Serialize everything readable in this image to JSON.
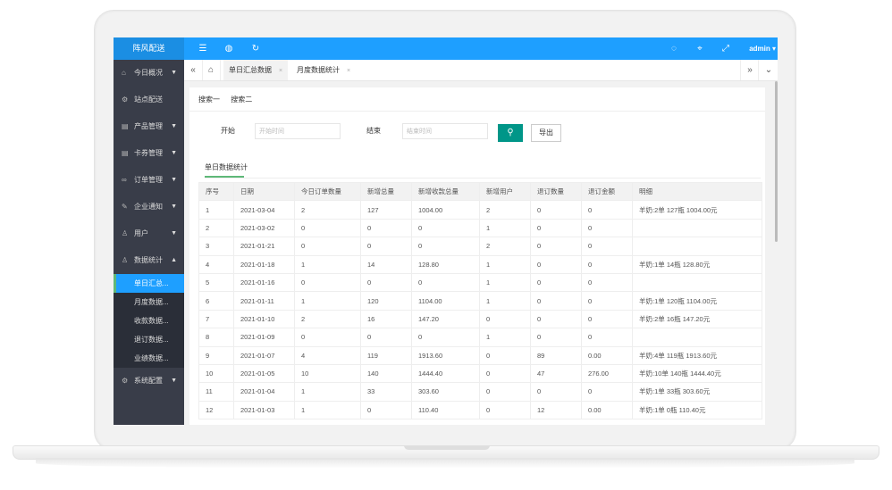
{
  "app": {
    "brand": "阵风配送",
    "user": "admin"
  },
  "topbar": {
    "icons": [
      "menu-icon",
      "globe-icon",
      "refresh-icon",
      "palette-icon",
      "tag-icon",
      "fullscreen-icon"
    ]
  },
  "sidebar": {
    "items": [
      {
        "label": "今日概况",
        "icon": "home-icon",
        "arrow": "▼"
      },
      {
        "label": "站点配送",
        "icon": "gear-icon",
        "arrow": ""
      },
      {
        "label": "产品管理",
        "icon": "doc-icon",
        "arrow": "▼"
      },
      {
        "label": "卡券管理",
        "icon": "doc-icon",
        "arrow": "▼"
      },
      {
        "label": "订单管理",
        "icon": "link-icon",
        "arrow": "▼"
      },
      {
        "label": "企业通知",
        "icon": "edit-icon",
        "arrow": "▼"
      },
      {
        "label": "用户",
        "icon": "user-icon",
        "arrow": "▼"
      },
      {
        "label": "数据统计",
        "icon": "user-icon",
        "arrow": "▲"
      }
    ],
    "subitems": [
      "单日汇总...",
      "月度数据...",
      "收款数据...",
      "退订数据...",
      "业绩数据..."
    ],
    "last": {
      "label": "系统配置",
      "icon": "gear-icon",
      "arrow": "▼"
    }
  },
  "tabs": {
    "home_icon": "⌂",
    "items": [
      {
        "label": "单日汇总数据",
        "close": "×"
      },
      {
        "label": "月度数据统计",
        "close": "×"
      }
    ]
  },
  "search": {
    "tabs": [
      "搜索一",
      "搜索二"
    ],
    "start_label": "开始",
    "start_placeholder": "开始时间",
    "end_label": "结束",
    "end_placeholder": "结束时间",
    "export_label": "导出"
  },
  "section_title": "单日数据统计",
  "table": {
    "headers": [
      "序号",
      "日期",
      "今日订单数量",
      "新增总量",
      "新增收款总量",
      "新增用户",
      "退订数量",
      "退订金额",
      "明细"
    ],
    "rows": [
      [
        "1",
        "2021-03-04",
        "2",
        "127",
        "1004.00",
        "2",
        "0",
        "0",
        "羊奶:2单 127瓶 1004.00元"
      ],
      [
        "2",
        "2021-03-02",
        "0",
        "0",
        "0",
        "1",
        "0",
        "0",
        ""
      ],
      [
        "3",
        "2021-01-21",
        "0",
        "0",
        "0",
        "2",
        "0",
        "0",
        ""
      ],
      [
        "4",
        "2021-01-18",
        "1",
        "14",
        "128.80",
        "1",
        "0",
        "0",
        "羊奶:1单 14瓶 128.80元"
      ],
      [
        "5",
        "2021-01-16",
        "0",
        "0",
        "0",
        "1",
        "0",
        "0",
        ""
      ],
      [
        "6",
        "2021-01-11",
        "1",
        "120",
        "1104.00",
        "1",
        "0",
        "0",
        "羊奶:1单 120瓶 1104.00元"
      ],
      [
        "7",
        "2021-01-10",
        "2",
        "16",
        "147.20",
        "0",
        "0",
        "0",
        "羊奶:2单 16瓶 147.20元"
      ],
      [
        "8",
        "2021-01-09",
        "0",
        "0",
        "0",
        "1",
        "0",
        "0",
        ""
      ],
      [
        "9",
        "2021-01-07",
        "4",
        "119",
        "1913.60",
        "0",
        "89",
        "0.00",
        "羊奶:4单 119瓶 1913.60元"
      ],
      [
        "10",
        "2021-01-05",
        "10",
        "140",
        "1444.40",
        "0",
        "47",
        "276.00",
        "羊奶:10单 140瓶 1444.40元"
      ],
      [
        "11",
        "2021-01-04",
        "1",
        "33",
        "303.60",
        "0",
        "0",
        "0",
        "羊奶:1单 33瓶 303.60元"
      ],
      [
        "12",
        "2021-01-03",
        "1",
        "0",
        "110.40",
        "0",
        "12",
        "0.00",
        "羊奶:1单 0瓶 110.40元"
      ]
    ]
  }
}
